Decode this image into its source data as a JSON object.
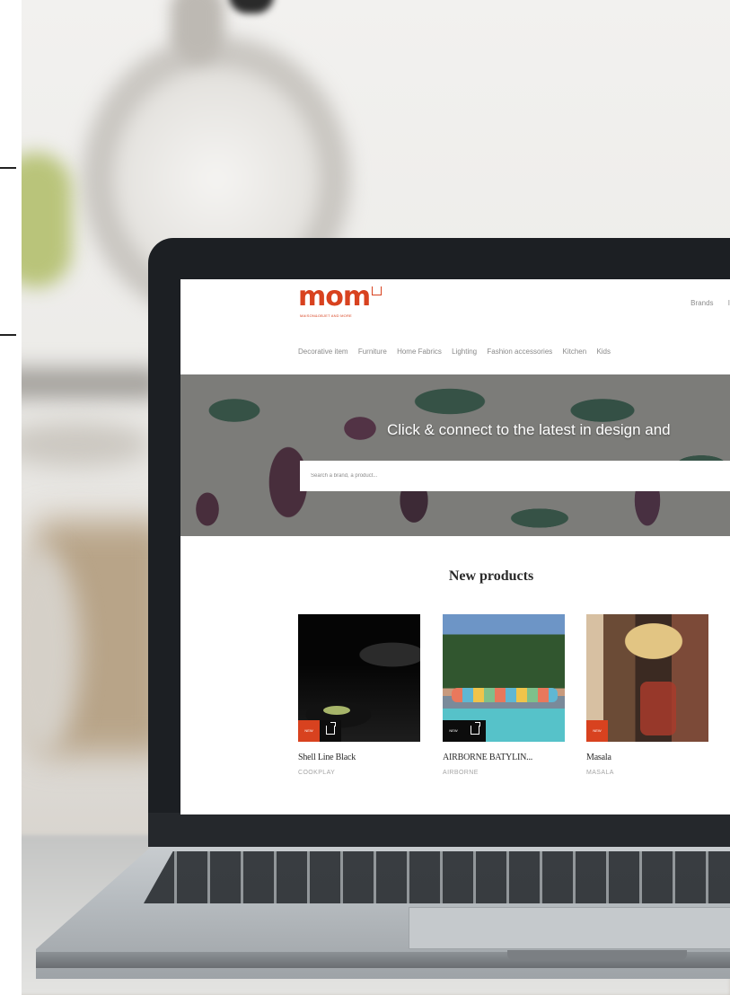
{
  "site": {
    "logo_text": "mom",
    "logo_tagline": "MAISON&OBJET AND MORE",
    "top_links": [
      "Brands",
      "I"
    ],
    "nav_items": [
      "Decorative item",
      "Furniture",
      "Home Fabrics",
      "Lighting",
      "Fashion accessories",
      "Kitchen",
      "Kids"
    ]
  },
  "hero": {
    "headline": "Click & connect to the latest in design and",
    "search_placeholder": "Search a brand, a product..."
  },
  "new_products": {
    "title": "New products",
    "items": [
      {
        "name": "Shell Line Black",
        "brand": "COOKPLAY",
        "badge": "NEW",
        "thumb": "dark"
      },
      {
        "name": "AIRBORNE BATYLIN...",
        "brand": "AIRBORNE",
        "badge": "NEW",
        "thumb": "pool"
      },
      {
        "name": "Masala",
        "brand": "MASALA",
        "badge": "NEW",
        "thumb": "boho"
      }
    ]
  },
  "colors": {
    "brand": "#d8421f",
    "laptop_bezel": "#1c1f23",
    "text_muted": "#8a8a8a"
  }
}
